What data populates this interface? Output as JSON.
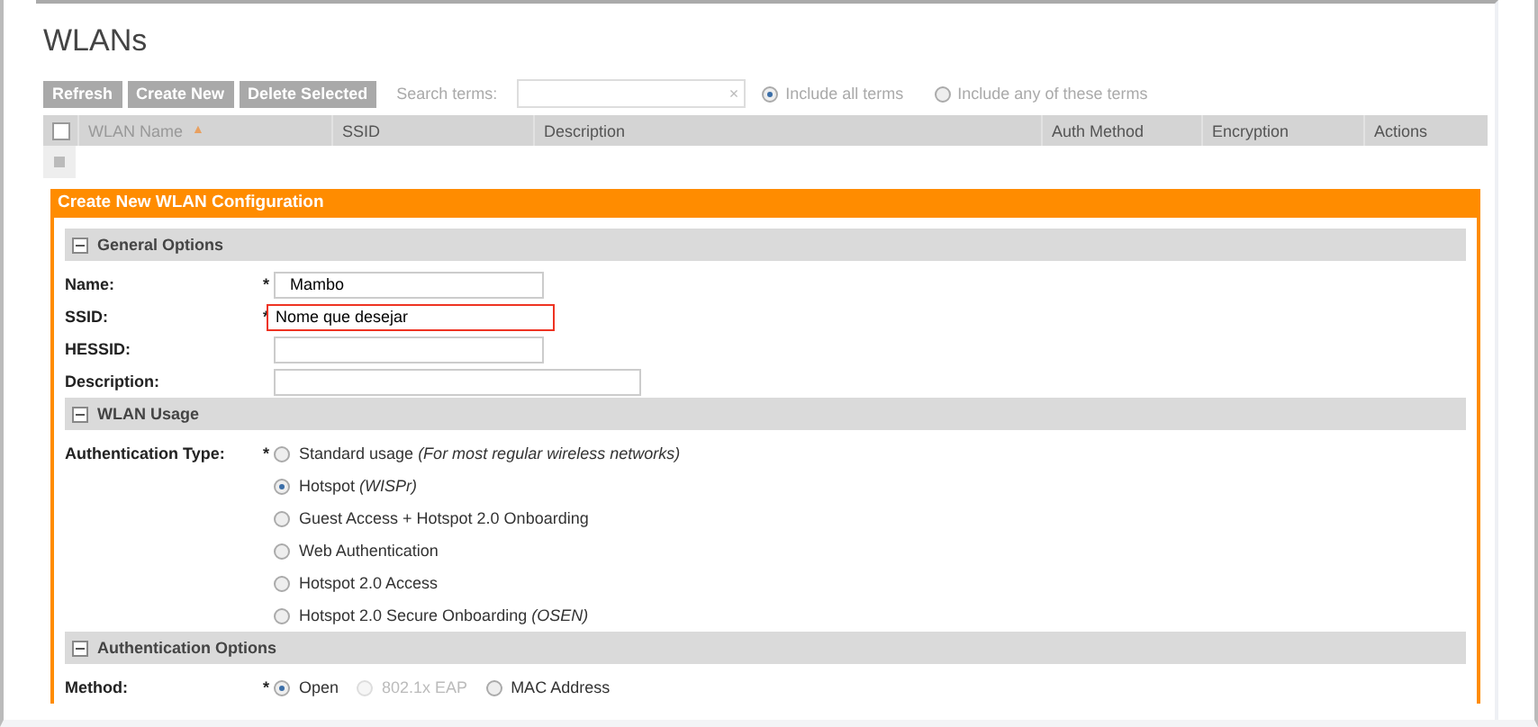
{
  "page_title": "WLANs",
  "toolbar": {
    "buttons": [
      {
        "label": "Refresh",
        "disabled": true
      },
      {
        "label": "Create New",
        "disabled": true
      },
      {
        "label": "Delete Selected",
        "disabled": true
      }
    ],
    "search_label": "Search terms:",
    "clear": "×",
    "search_options": [
      {
        "label": "Include all terms",
        "selected": true
      },
      {
        "label": "Include any of these terms",
        "selected": false
      }
    ]
  },
  "table": {
    "select_all_checked": false,
    "columns": [
      {
        "label": "WLAN Name",
        "sort": "▲"
      },
      {
        "label": "SSID"
      },
      {
        "label": "Description"
      },
      {
        "label": "Auth Method"
      },
      {
        "label": "Encryption"
      },
      {
        "label": "Actions"
      }
    ],
    "row_checked": false
  },
  "panel": {
    "title": "Create New WLAN Configuration",
    "sections": [
      {
        "title": "General Options",
        "expanded": true,
        "kind": "fields",
        "fields": [
          {
            "label": "Name:",
            "required_mark": "*",
            "value": "Mambo",
            "highlighted": false,
            "wide": false
          },
          {
            "label": "SSID:",
            "required_mark": "*",
            "value": "Nome que desejar",
            "highlighted": true,
            "wide": false
          },
          {
            "label": "HESSID:",
            "highlighted": false,
            "wide": false
          },
          {
            "label": "Description:",
            "highlighted": false,
            "wide": true
          }
        ]
      },
      {
        "title": "WLAN Usage",
        "expanded": true,
        "kind": "radio-list",
        "label": "Authentication Type:",
        "required_mark": "*",
        "options": [
          {
            "label": "Standard usage *(For most regular wireless networks)*",
            "selected": false,
            "disabled": false
          },
          {
            "label": "Hotspot *(WISPr)*",
            "selected": true,
            "disabled": false
          },
          {
            "label": "Guest Access + Hotspot 2.0 Onboarding",
            "selected": false,
            "disabled": false
          },
          {
            "label": "Web Authentication",
            "selected": false,
            "disabled": false
          },
          {
            "label": "Hotspot 2.0 Access",
            "selected": false,
            "disabled": false
          },
          {
            "label": "Hotspot 2.0 Secure Onboarding *(OSEN)*",
            "selected": false,
            "disabled": false
          }
        ]
      },
      {
        "title": "Authentication Options",
        "expanded": true,
        "kind": "radio-inline",
        "label": "Method:",
        "required_mark": "*",
        "options": [
          {
            "label": "Open",
            "selected": true,
            "disabled": false
          },
          {
            "label": "802.1x EAP",
            "selected": false,
            "disabled": true
          },
          {
            "label": "MAC Address",
            "selected": false,
            "disabled": false
          }
        ]
      }
    ]
  }
}
